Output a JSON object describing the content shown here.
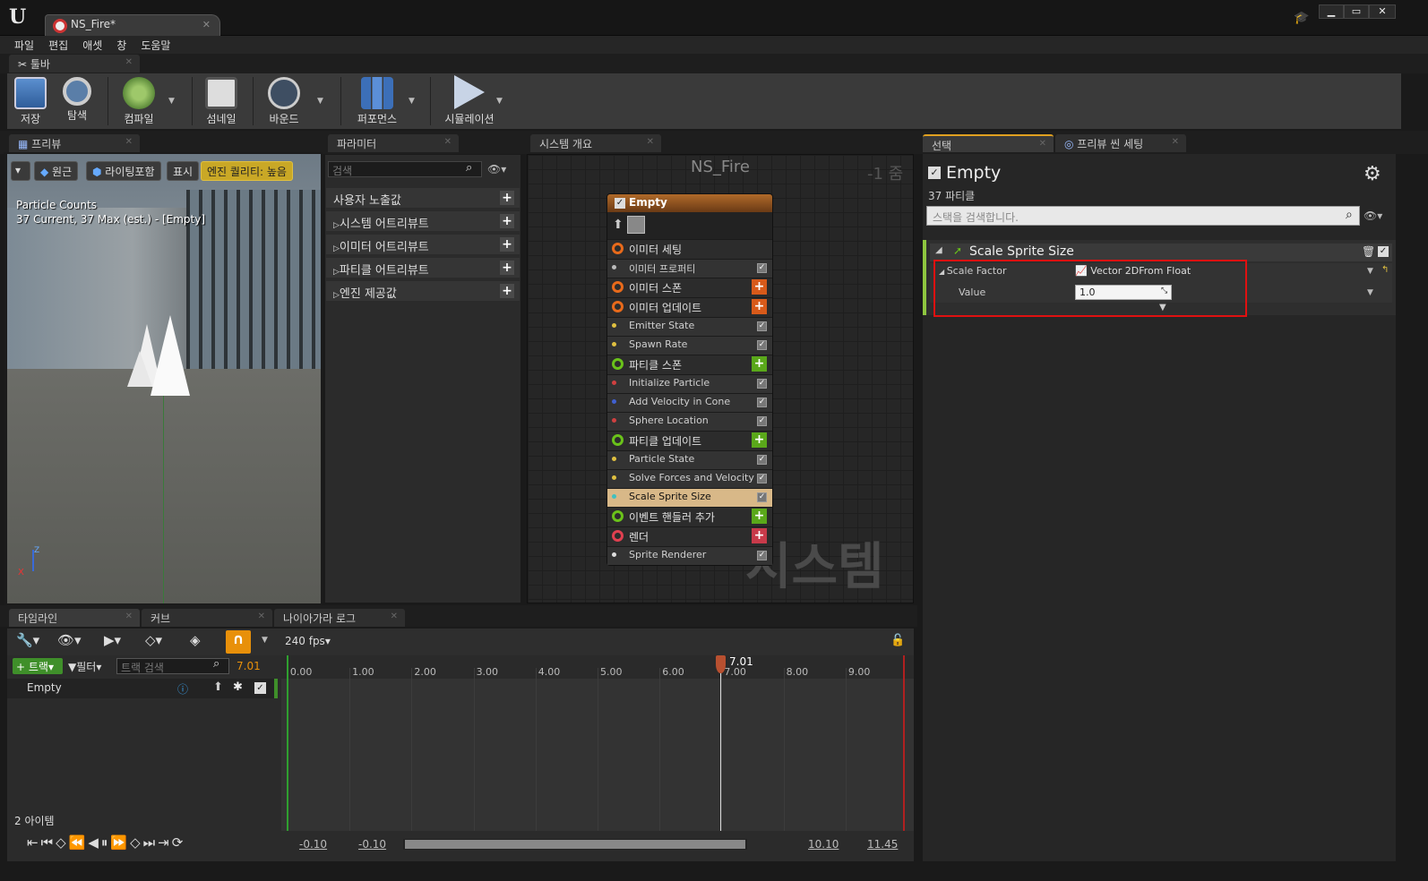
{
  "window": {
    "doc_tab": "NS_Fire*",
    "minimize": "▁",
    "maximize": "▭",
    "close": "✕"
  },
  "menu": [
    "파일",
    "편집",
    "애셋",
    "창",
    "도움말"
  ],
  "toolbar": {
    "tab": "툴바",
    "buttons": [
      {
        "label": "저장",
        "icon": "save-icon"
      },
      {
        "label": "탐색",
        "icon": "browse-icon"
      },
      {
        "label": "컴파일",
        "icon": "compile-icon"
      },
      {
        "label": "섬네일",
        "icon": "thumbnail-icon"
      },
      {
        "label": "바운드",
        "icon": "bounds-icon"
      },
      {
        "label": "퍼포먼스",
        "icon": "performance-icon"
      },
      {
        "label": "시뮬레이션",
        "icon": "play-icon"
      }
    ]
  },
  "preview": {
    "tab": "프리뷰",
    "buttons": [
      "원근",
      "라이팅포함",
      "표시",
      "엔진 퀄리티: 높음"
    ],
    "stats_title": "Particle Counts",
    "stats_line": "37 Current, 37 Max (est.) - [Empty]"
  },
  "parameters": {
    "tab": "파라미터",
    "search_placeholder": "검색",
    "rows": [
      "사용자 노출값",
      "시스템 어트리뷰트",
      "이미터 어트리뷰트",
      "파티클 어트리뷰트",
      "엔진 제공값"
    ]
  },
  "system_overview": {
    "tab": "시스템 개요",
    "title": "NS_Fire",
    "zoom": "-1 줌",
    "watermark": "시스템",
    "node": {
      "title": "Empty",
      "rows": [
        {
          "label": "이미터 세팅",
          "kind": "section",
          "color": "#e86a1b"
        },
        {
          "label": "이미터 프로퍼티",
          "kind": "item",
          "color": "#bbbbbb"
        },
        {
          "label": "이미터 스폰",
          "kind": "section",
          "color": "#e86a1b",
          "add": "#d85a1a"
        },
        {
          "label": "이미터 업데이트",
          "kind": "section",
          "color": "#e86a1b",
          "add": "#d85a1a"
        },
        {
          "label": "Emitter State",
          "kind": "item",
          "color": "#e0c040"
        },
        {
          "label": "Spawn Rate",
          "kind": "item",
          "color": "#e0c040"
        },
        {
          "label": "파티클 스폰",
          "kind": "section",
          "color": "#6ac21a",
          "add": "#5aa81a"
        },
        {
          "label": "Initialize Particle",
          "kind": "item",
          "color": "#d04040"
        },
        {
          "label": "Add Velocity in Cone",
          "kind": "item",
          "color": "#4060d0"
        },
        {
          "label": "Sphere Location",
          "kind": "item",
          "color": "#d04040"
        },
        {
          "label": "파티클 업데이트",
          "kind": "section",
          "color": "#6ac21a",
          "add": "#5aa81a"
        },
        {
          "label": "Particle State",
          "kind": "item",
          "color": "#e0c040"
        },
        {
          "label": "Solve Forces and Velocity",
          "kind": "item",
          "color": "#e0c040"
        },
        {
          "label": "Scale Sprite Size",
          "kind": "item",
          "color": "#40c0c0",
          "selected": true
        },
        {
          "label": "이벤트 핸들러 추가",
          "kind": "section",
          "color": "#6ac21a",
          "add": "#5aa81a"
        },
        {
          "label": "렌더",
          "kind": "section",
          "color": "#e04050",
          "add": "#c83a4a"
        },
        {
          "label": "Sprite Renderer",
          "kind": "item",
          "color": "#dddddd"
        }
      ]
    }
  },
  "selection": {
    "tab": "선택",
    "tab2": "프리뷰 씬 세팅",
    "title": "Empty",
    "subtitle": "37 파티클",
    "search_placeholder": "스택을 검색합니다.",
    "module": "Scale Sprite Size",
    "param_name": "Scale Factor",
    "param_type": "Vector 2DFrom Float",
    "value_label": "Value",
    "value": "1.0"
  },
  "timeline": {
    "tabs": [
      "타임라인",
      "커브",
      "나이아가라 로그"
    ],
    "fps": "240 fps",
    "track_button": "트랙",
    "filter_button": "필터",
    "search_placeholder": "트랙 검색",
    "current_time": "7.01",
    "track_name": "Empty",
    "item_count": "2 아이템",
    "ruler": [
      "0.00",
      "1.00",
      "2.00",
      "3.00",
      "4.00",
      "5.00",
      "6.00",
      "7.00",
      "8.00",
      "9.00"
    ],
    "range_start": "-0.10",
    "view_start": "-0.10",
    "view_end": "10.10",
    "range_end": "11.45"
  }
}
